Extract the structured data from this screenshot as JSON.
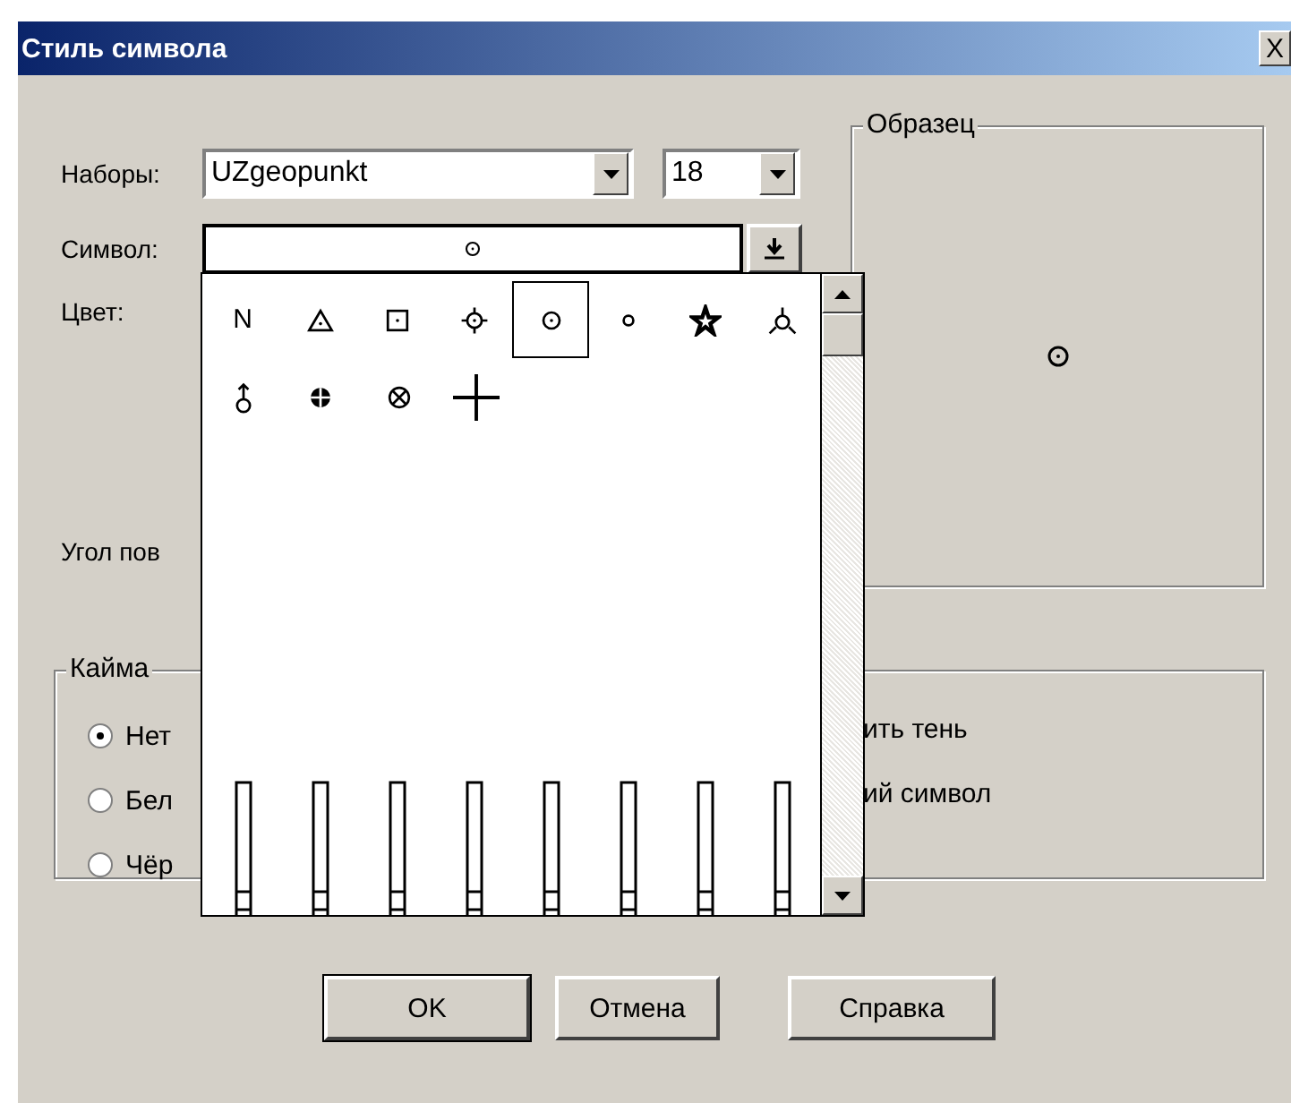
{
  "window": {
    "title": "Стиль символа",
    "close": "X"
  },
  "fields": [
    {
      "label": "Наборы:",
      "value": "UZgeopunkt",
      "size": "18"
    }
  ],
  "symbol_label": "Символ:",
  "color_label": "Цвет:",
  "angle_label": "Угол пов",
  "sample": {
    "title": "Образец"
  },
  "border_group": {
    "title": "Кайма",
    "options": [
      {
        "label": "Нет",
        "selected": true
      },
      {
        "label": "Бел",
        "selected": false
      },
      {
        "label": "Чёр",
        "selected": false
      }
    ]
  },
  "options_group": {
    "items": [
      "ить тень",
      "ий  символ"
    ]
  },
  "symbol_list": {
    "rows": [
      {
        "items": [
          {
            "kind": "letter",
            "text": "N",
            "selected": false
          },
          {
            "kind": "triangle",
            "selected": false
          },
          {
            "kind": "square",
            "selected": false
          },
          {
            "kind": "crosshair",
            "selected": false
          },
          {
            "kind": "circle-dot",
            "selected": true
          },
          {
            "kind": "small-circle",
            "selected": false
          },
          {
            "kind": "star",
            "selected": false
          },
          {
            "kind": "tripod",
            "selected": false
          }
        ]
      },
      {
        "items": [
          {
            "kind": "arrow-circle",
            "selected": false
          },
          {
            "kind": "filled-circle",
            "selected": false
          },
          {
            "kind": "x-circle",
            "selected": false
          },
          {
            "kind": "plus",
            "selected": false
          }
        ]
      },
      {
        "items": [
          {
            "kind": "bar",
            "selected": false
          },
          {
            "kind": "bar",
            "selected": false
          },
          {
            "kind": "bar",
            "selected": false
          },
          {
            "kind": "bar",
            "selected": false
          },
          {
            "kind": "bar",
            "selected": false
          },
          {
            "kind": "bar",
            "selected": false
          },
          {
            "kind": "bar",
            "selected": false
          },
          {
            "kind": "bar",
            "selected": false
          }
        ]
      }
    ]
  },
  "buttons": [
    {
      "label": "OK",
      "default": true
    },
    {
      "label": "Отмена",
      "default": false
    },
    {
      "label": "Справка",
      "default": false
    }
  ]
}
